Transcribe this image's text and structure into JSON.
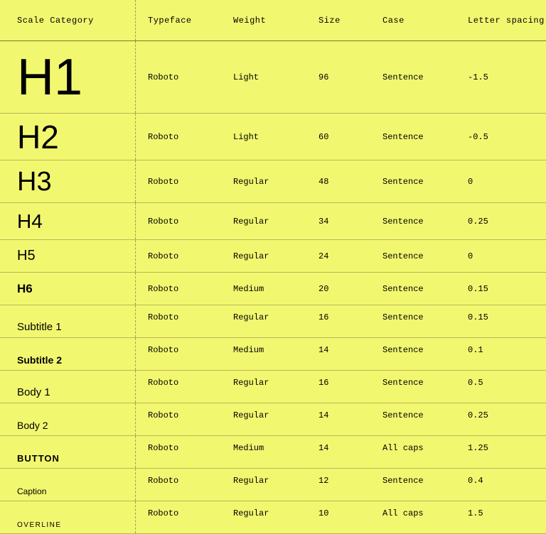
{
  "headers": {
    "scale_category": "Scale Category",
    "typeface": "Typeface",
    "weight": "Weight",
    "size": "Size",
    "case": "Case",
    "letter_spacing": "Letter spacing"
  },
  "chart_data": {
    "type": "table",
    "columns": [
      "Scale Category",
      "Typeface",
      "Weight",
      "Size",
      "Case",
      "Letter spacing"
    ],
    "rows": [
      {
        "label": "H1",
        "typeface": "Roboto",
        "weight": "Light",
        "size": "96",
        "case": "Sentence",
        "letter_spacing": "-1.5"
      },
      {
        "label": "H2",
        "typeface": "Roboto",
        "weight": "Light",
        "size": "60",
        "case": "Sentence",
        "letter_spacing": "-0.5"
      },
      {
        "label": "H3",
        "typeface": "Roboto",
        "weight": "Regular",
        "size": "48",
        "case": "Sentence",
        "letter_spacing": "0"
      },
      {
        "label": "H4",
        "typeface": "Roboto",
        "weight": "Regular",
        "size": "34",
        "case": "Sentence",
        "letter_spacing": "0.25"
      },
      {
        "label": "H5",
        "typeface": "Roboto",
        "weight": "Regular",
        "size": "24",
        "case": "Sentence",
        "letter_spacing": "0"
      },
      {
        "label": "H6",
        "typeface": "Roboto",
        "weight": "Medium",
        "size": "20",
        "case": "Sentence",
        "letter_spacing": "0.15"
      },
      {
        "label": "Subtitle 1",
        "typeface": "Roboto",
        "weight": "Regular",
        "size": "16",
        "case": "Sentence",
        "letter_spacing": "0.15"
      },
      {
        "label": "Subtitle 2",
        "typeface": "Roboto",
        "weight": "Medium",
        "size": "14",
        "case": "Sentence",
        "letter_spacing": "0.1"
      },
      {
        "label": "Body 1",
        "typeface": "Roboto",
        "weight": "Regular",
        "size": "16",
        "case": "Sentence",
        "letter_spacing": "0.5"
      },
      {
        "label": "Body 2",
        "typeface": "Roboto",
        "weight": "Regular",
        "size": "14",
        "case": "Sentence",
        "letter_spacing": "0.25"
      },
      {
        "label": "BUTTON",
        "typeface": "Roboto",
        "weight": "Medium",
        "size": "14",
        "case": "All caps",
        "letter_spacing": "1.25"
      },
      {
        "label": "Caption",
        "typeface": "Roboto",
        "weight": "Regular",
        "size": "12",
        "case": "Sentence",
        "letter_spacing": "0.4"
      },
      {
        "label": "OVERLINE",
        "typeface": "Roboto",
        "weight": "Regular",
        "size": "10",
        "case": "All caps",
        "letter_spacing": "1.5"
      }
    ]
  }
}
